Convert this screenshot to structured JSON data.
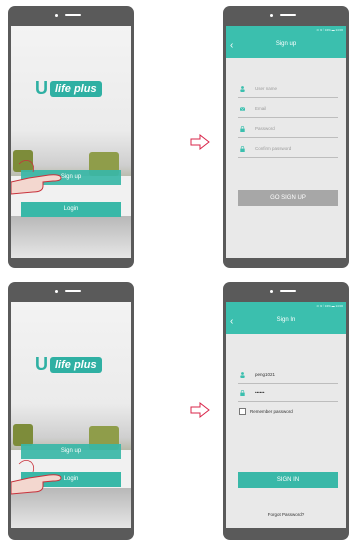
{
  "colors": {
    "accent": "#3bbfae",
    "frame": "#5a5a5a",
    "grey_button": "#a7a7a7",
    "arrow": "#d9254a"
  },
  "splash": {
    "brand_u": "U",
    "brand_name": "life plus",
    "signup_label": "Sign up",
    "login_label": "Login"
  },
  "signup": {
    "title": "Sign up",
    "status": "⊙ ≋ ⫶ 34% ▬ 14:00",
    "username_placeholder": "User name",
    "email_placeholder": "Email",
    "password_placeholder": "Password",
    "confirm_placeholder": "Confirm password",
    "go_button": "GO SIGN UP"
  },
  "signin": {
    "title": "Sign In",
    "status": "⊙ ≋ ⫶ 34% ▬ 14:00",
    "username_value": "peng1021",
    "password_value": "••••••",
    "remember_label": "Remember password",
    "signin_button": "SIGN IN",
    "forgot_label": "Forgot Password?"
  },
  "icons": [
    "user-icon",
    "mail-icon",
    "lock-icon",
    "back-chevron-icon",
    "right-arrow-icon",
    "hand-gesture-icon"
  ]
}
